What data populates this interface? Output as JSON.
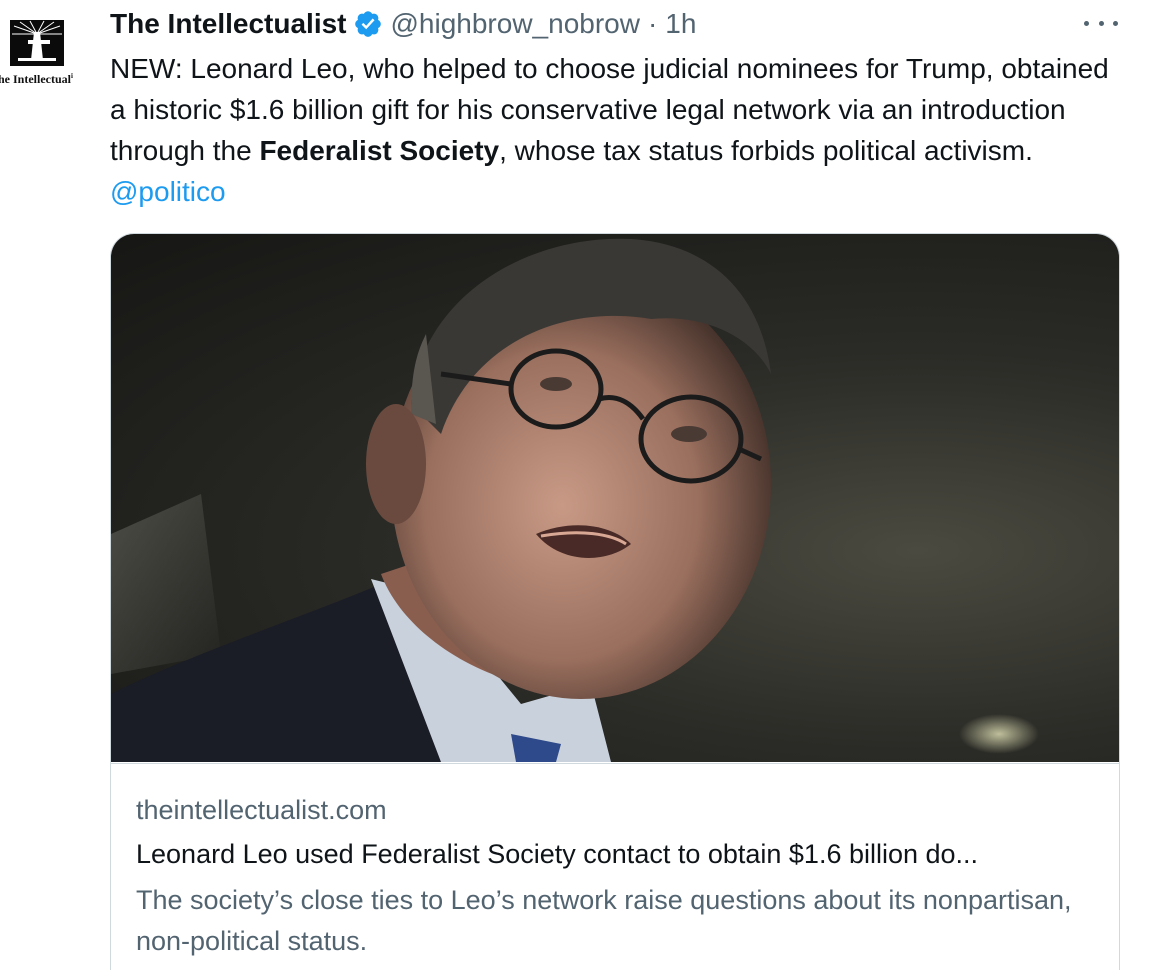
{
  "author": {
    "display_name": "The Intellectualist",
    "handle": "@highbrow_nobrow",
    "separator": "·",
    "timestamp": "1h",
    "verified": true,
    "avatar_caption": "he Intellectual",
    "avatar_caption_mark": "i",
    "avatar_icon": "lighthouse-logo-icon"
  },
  "tweet": {
    "text_before_bold": "NEW: Leonard Leo, who helped to choose judicial nominees for Trump, obtained a historic $1.6 billion gift for his conservative legal network via an introduction through the ",
    "text_bold": "Federalist Society",
    "text_after_bold": ", whose tax status forbids political activism. ",
    "mention": "@politico"
  },
  "link_card": {
    "domain": "theintellectualist.com",
    "title": "Leonard Leo used Federalist Society contact to obtain $1.6 billion do...",
    "description": "The society’s close ties to Leo’s network raise questions about its nonpartisan, non-political status.",
    "image_subject": "photo of a man in glasses and a dark suit looking up"
  },
  "colors": {
    "text_primary": "#0f1419",
    "text_secondary": "#536471",
    "accent": "#1d9bf0",
    "border": "#cfd9de"
  }
}
